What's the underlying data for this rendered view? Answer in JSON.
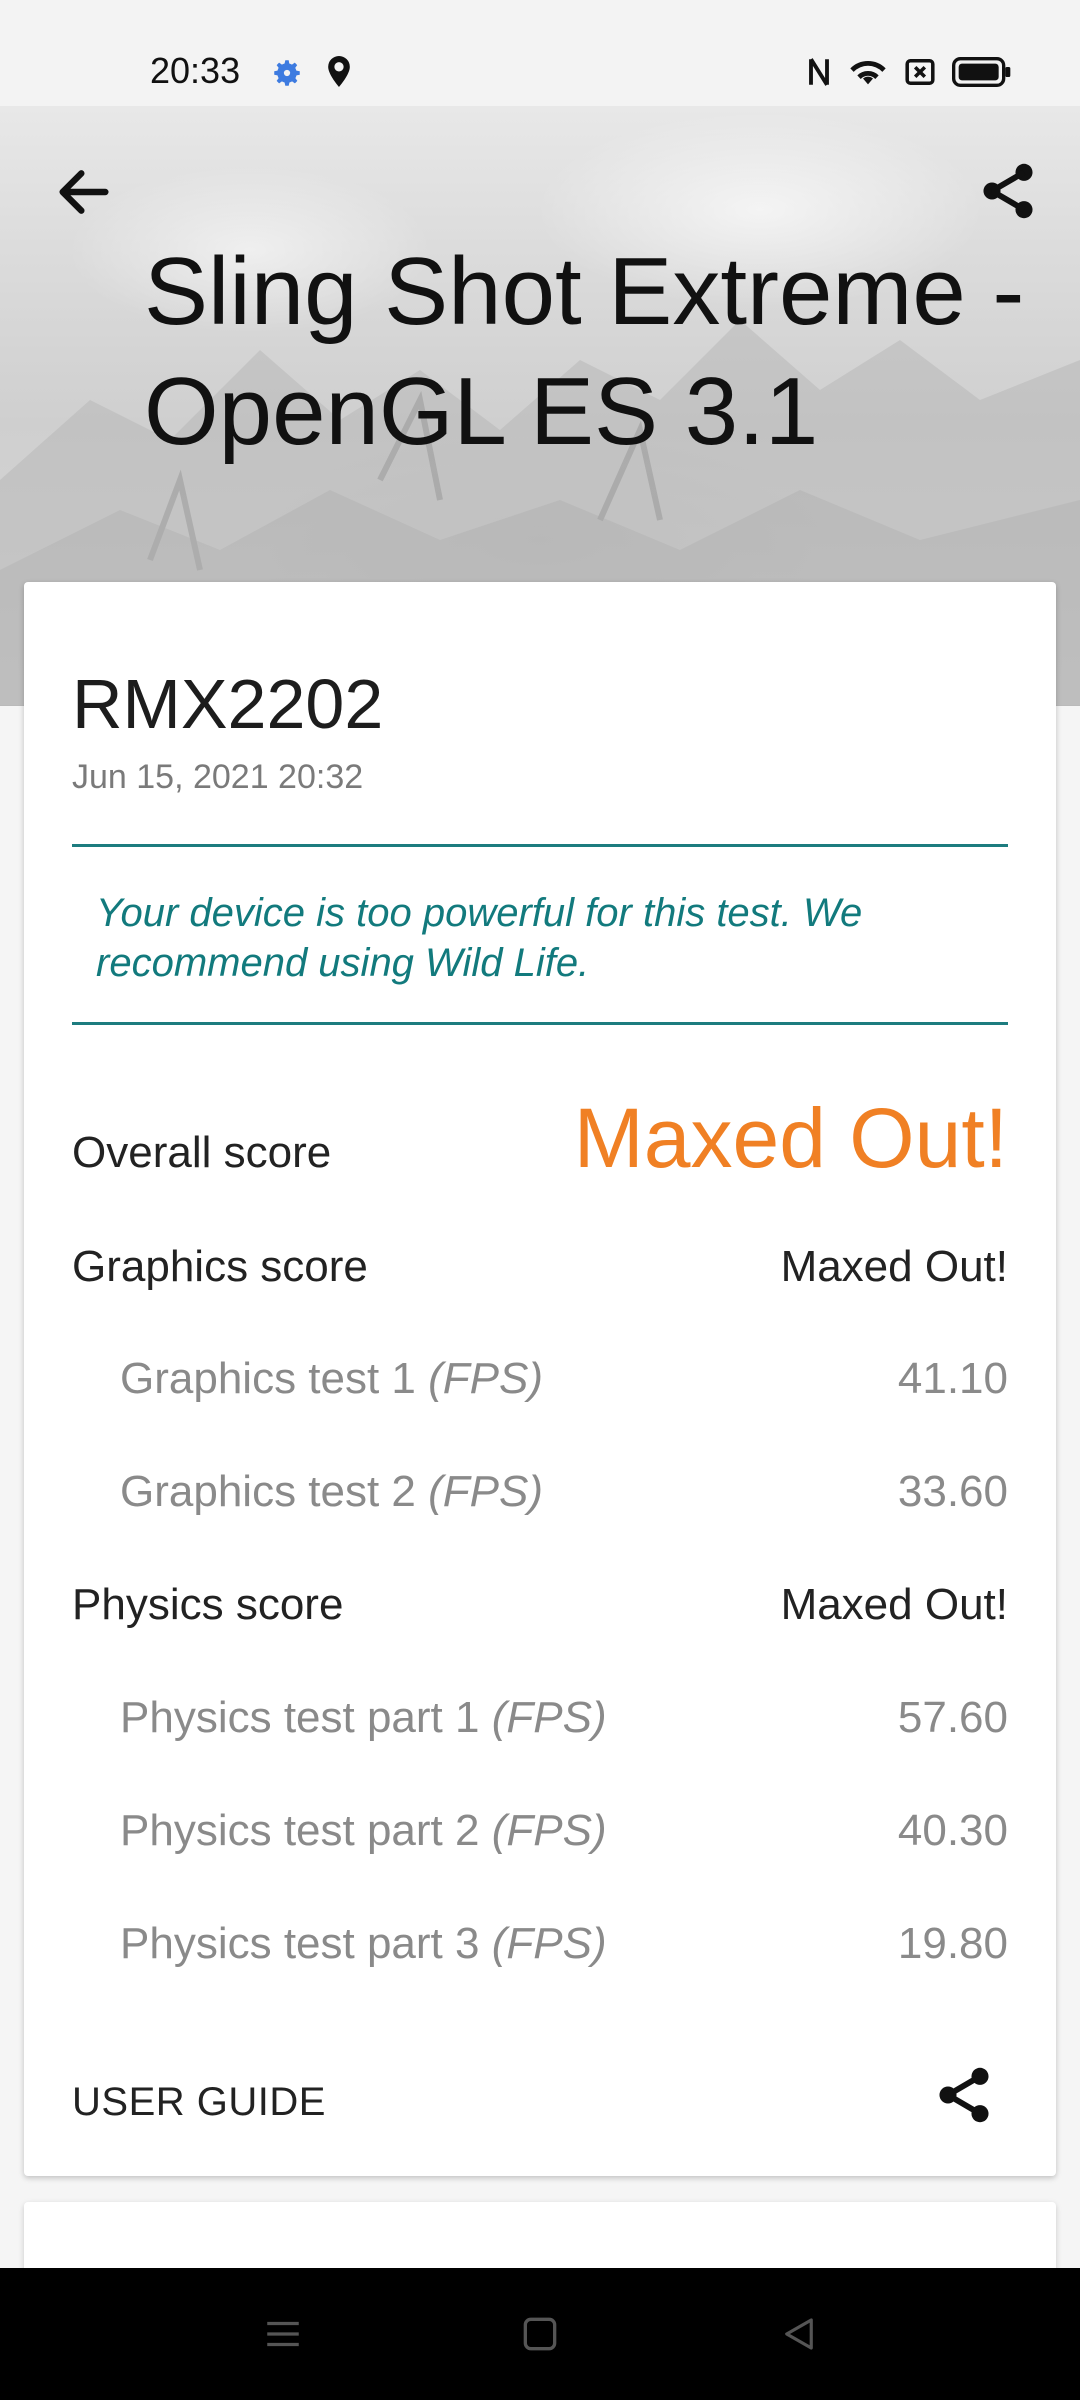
{
  "status_bar": {
    "time": "20:33",
    "left_icons": [
      "gear-icon",
      "location-pin-icon"
    ],
    "right_icons": [
      "nfc-icon",
      "wifi-icon",
      "no-sim-icon",
      "battery-icon"
    ]
  },
  "header": {
    "back_icon": "arrow-left-icon",
    "share_icon": "share-icon",
    "title": "Sling Shot Extreme - OpenGL ES 3.1"
  },
  "result_card": {
    "device_name": "RMX2202",
    "date": "Jun 15, 2021 20:32",
    "notice": "Your device is too powerful for this test. We recommend using Wild Life.",
    "overall": {
      "label": "Overall score",
      "value": "Maxed Out!"
    },
    "graphics": {
      "label": "Graphics score",
      "value": "Maxed Out!",
      "tests": [
        {
          "label": "Graphics test 1",
          "unit": "(FPS)",
          "value": "41.10"
        },
        {
          "label": "Graphics test 2",
          "unit": "(FPS)",
          "value": "33.60"
        }
      ]
    },
    "physics": {
      "label": "Physics score",
      "value": "Maxed Out!",
      "tests": [
        {
          "label": "Physics test part 1",
          "unit": "(FPS)",
          "value": "57.60"
        },
        {
          "label": "Physics test part 2",
          "unit": "(FPS)",
          "value": "40.30"
        },
        {
          "label": "Physics test part 3",
          "unit": "(FPS)",
          "value": "19.80"
        }
      ]
    },
    "user_guide_label": "USER GUIDE",
    "share_icon": "share-icon"
  },
  "colors": {
    "accent_teal": "#127a7d",
    "maxed_out_orange": "#f08024",
    "nav_bar": "#000000"
  },
  "nav_bar": {
    "icons": [
      "menu-icon",
      "home-icon",
      "back-triangle-icon"
    ]
  }
}
